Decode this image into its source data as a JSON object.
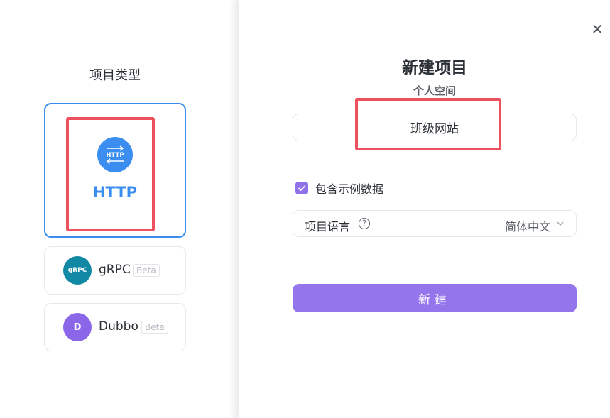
{
  "left": {
    "section_title": "项目类型",
    "types": [
      {
        "label": "HTTP",
        "icon": "http-icon",
        "icon_text": "HTTP",
        "selected": true
      },
      {
        "label": "gRPC",
        "icon": "grpc-icon",
        "icon_text": "gRPC",
        "badge": "Beta"
      },
      {
        "label": "Dubbo",
        "icon": "dubbo-icon",
        "icon_text": "D",
        "badge": "Beta"
      }
    ]
  },
  "dialog": {
    "title": "新建项目",
    "subtitle": "个人空间",
    "project_name": "班级网站",
    "include_sample_label": "包含示例数据",
    "include_sample_checked": true,
    "language_label": "项目语言",
    "language_value": "简体中文",
    "create_label": "新建",
    "close_icon": "close-icon"
  },
  "colors": {
    "accent_blue": "#3b8ef0",
    "accent_purple": "#9575eb",
    "highlight_red": "#ef5060",
    "grpc": "#1189a4",
    "dubbo": "#8b66e8"
  }
}
